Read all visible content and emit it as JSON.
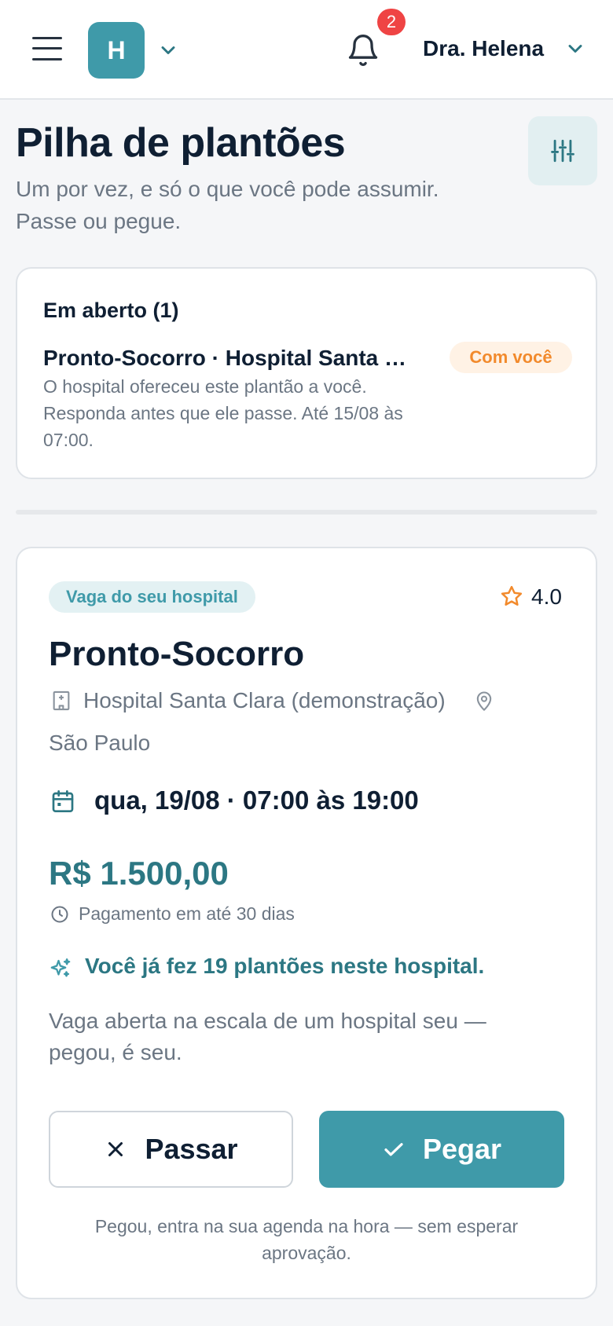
{
  "header": {
    "org_initial": "H",
    "notification_count": "2",
    "user_name": "Dra. Helena"
  },
  "page": {
    "title": "Pilha de plantões",
    "subtitle": "Um por vez, e só o que você pode assumir. Passe ou pegue."
  },
  "open_section": {
    "heading": "Em aberto (1)",
    "item_title": "Pronto-Socorro · Hospital Santa Clara (demonstração)",
    "item_description": "O hospital ofereceu este plantão a você. Responda antes que ele passe. Até 15/08 às 07:00.",
    "status": "Com você"
  },
  "shift": {
    "tag": "Vaga do seu hospital",
    "rating": "4.0",
    "title": "Pronto-Socorro",
    "hospital": "Hospital Santa Clara (demonstração)",
    "city": "São Paulo",
    "datetime": "qua, 19/08 · 07:00 às 19:00",
    "price": "R$ 1.500,00",
    "payment_terms": "Pagamento em até 30 dias",
    "history": "Você já fez 19 plantões neste hospital.",
    "note": "Vaga aberta na escala de um hospital seu — pegou, é seu.",
    "pass_label": "Passar",
    "take_label": "Pegar",
    "footnote": "Pegou, entra na sua agenda na hora — sem esperar aprovação."
  },
  "icons": {
    "menu": "hamburger-menu-icon",
    "org_chevron": "chevron-down-icon",
    "notifications": "bell-icon",
    "user_chevron": "chevron-down-icon",
    "filters": "sliders-icon",
    "rating": "star-icon",
    "hospital": "building-icon",
    "location": "map-pin-icon",
    "date": "calendar-icon",
    "payment": "clock-icon",
    "history": "sparkles-icon",
    "pass": "x-icon",
    "take": "check-icon"
  },
  "colors": {
    "accent": "#3f9aa9",
    "accent_dark": "#2c7783",
    "status_orange": "#f28a2c",
    "badge_red": "#ef4444"
  }
}
